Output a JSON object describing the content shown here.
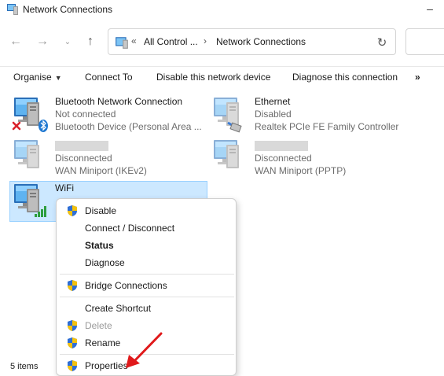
{
  "window": {
    "title": "Network Connections"
  },
  "nav": {
    "back_icon": "arrow-left-icon",
    "forward_icon": "arrow-right-icon",
    "recent_icon": "chevron-down-icon",
    "up_icon": "arrow-up-icon",
    "breadcrumb": {
      "overflow": "«",
      "segments": [
        "All Control ...",
        "Network Connections"
      ],
      "separator": "›"
    },
    "refresh_icon": "refresh-icon"
  },
  "toolbar": {
    "organise": "Organise",
    "connect_to": "Connect To",
    "disable": "Disable this network device",
    "diagnose": "Diagnose this connection",
    "more": "»"
  },
  "connections": [
    {
      "name": "Bluetooth Network Connection",
      "status": "Not connected",
      "device": "Bluetooth Device (Personal Area ...",
      "icon": "bluetooth-network-icon"
    },
    {
      "name": "Ethernet",
      "status": "Disabled",
      "device": "Realtek PCIe FE Family Controller",
      "icon": "ethernet-network-icon"
    },
    {
      "name": "",
      "status": "Disconnected",
      "device": "WAN Miniport (IKEv2)",
      "icon": "network-icon"
    },
    {
      "name": "",
      "status": "Disconnected",
      "device": "WAN Miniport (PPTP)",
      "icon": "network-icon"
    },
    {
      "name": "WiFi",
      "status": "",
      "device": "",
      "icon": "wifi-network-icon",
      "selected": true
    }
  ],
  "status_bar": {
    "items_count": "5 items"
  },
  "context_menu": {
    "items": [
      {
        "label": "Disable",
        "shield": true
      },
      {
        "label": "Connect / Disconnect",
        "shield": false
      },
      {
        "label": "Status",
        "shield": false,
        "bold": true
      },
      {
        "label": "Diagnose",
        "shield": false
      },
      {
        "label": "Bridge Connections",
        "shield": true
      },
      {
        "label": "Create Shortcut",
        "shield": false
      },
      {
        "label": "Delete",
        "shield": true,
        "disabled": true
      },
      {
        "label": "Rename",
        "shield": true
      },
      {
        "label": "Properties",
        "shield": true
      }
    ]
  },
  "colors": {
    "selection": "#cce8ff",
    "selection_border": "#99d1ff",
    "annotation_arrow": "#e0191b"
  }
}
